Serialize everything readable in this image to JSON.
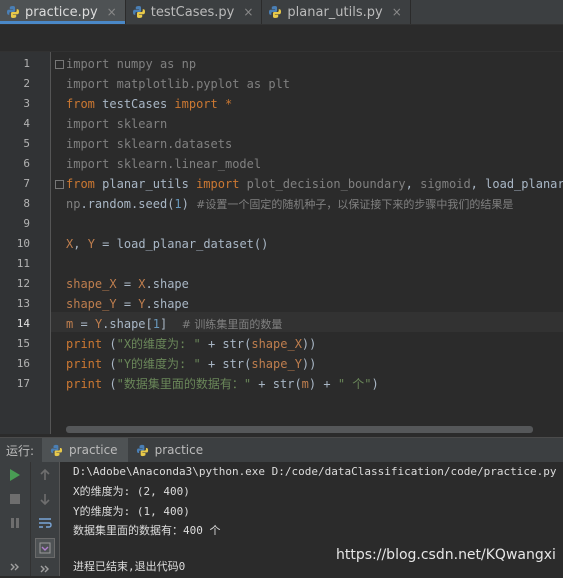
{
  "tabs": [
    {
      "label": "practice.py",
      "close": "×",
      "active": true
    },
    {
      "label": "testCases.py",
      "close": "×",
      "active": false
    },
    {
      "label": "planar_utils.py",
      "close": "×",
      "active": false
    }
  ],
  "editor": {
    "line_numbers": [
      "1",
      "2",
      "3",
      "4",
      "5",
      "6",
      "7",
      "8",
      "9",
      "10",
      "11",
      "12",
      "13",
      "14",
      "15",
      "16",
      "17"
    ],
    "current_line": 14,
    "lines": [
      "import numpy as np",
      "import matplotlib.pyplot as plt",
      "from testCases import *",
      "import sklearn",
      "import sklearn.datasets",
      "import sklearn.linear_model",
      "from planar_utils import plot_decision_boundary, sigmoid, load_planar_d",
      "np.random.seed(1) #设置一个固定的随机种子，以保证接下来的步骤中我们的结果是",
      "",
      "X, Y = load_planar_dataset()",
      "",
      "shape_X = X.shape",
      "shape_Y = Y.shape",
      "m = Y.shape[1]  # 训练集里面的数量",
      "print (\"X的维度为: \" + str(shape_X))",
      "print (\"Y的维度为: \" + str(shape_Y))",
      "print (\"数据集里面的数据有：\" + str(m) + \" 个\")"
    ]
  },
  "run_panel": {
    "label": "运行:",
    "tabs": [
      {
        "label": "practice",
        "active": true
      },
      {
        "label": "practice",
        "active": false
      }
    ],
    "output": [
      "D:\\Adobe\\Anaconda3\\python.exe D:/code/dataClassification/code/practice.py",
      "X的维度为: (2, 400)",
      "Y的维度为: (1, 400)",
      "数据集里面的数据有：400 个",
      "",
      "进程已结束,退出代码0"
    ]
  },
  "watermark": "https://blog.csdn.net/KQwangxi",
  "colors": {
    "keyword": "#cc7832",
    "string": "#6a8759",
    "number": "#6897bb",
    "comment": "#808080",
    "variable": "#bf7e4e",
    "default_text": "#a9b7c6",
    "run_green": "#499c54",
    "tab_underline": "#4a88c7"
  }
}
